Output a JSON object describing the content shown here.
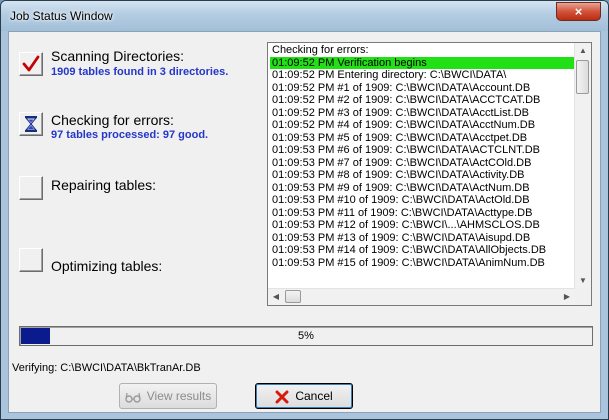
{
  "window": {
    "title": "Job Status Window",
    "close_label": "×"
  },
  "steps": [
    {
      "label": "Scanning Directories:",
      "sub": "1909 tables found in 3 directories.",
      "status_icon": "checkmark-icon"
    },
    {
      "label": "Checking for errors:",
      "sub": "97 tables processed:  97 good.",
      "status_icon": "hourglass-icon"
    },
    {
      "label": "Repairing tables:",
      "sub": "",
      "status_icon": ""
    },
    {
      "label": "Optimizing tables:",
      "sub": "",
      "status_icon": ""
    }
  ],
  "log": [
    "Checking for errors:",
    "01:09:52 PM Verification begins",
    "01:09:52 PM Entering directory: C:\\BWCI\\DATA\\",
    "01:09:52 PM    #1 of 1909: C:\\BWCI\\DATA\\Account.DB",
    "01:09:52 PM    #2 of 1909: C:\\BWCI\\DATA\\ACCTCAT.DB",
    "01:09:52 PM    #3 of 1909: C:\\BWCI\\DATA\\AcctList.DB",
    "01:09:52 PM    #4 of 1909: C:\\BWCI\\DATA\\AcctNum.DB",
    "01:09:53 PM    #5 of 1909: C:\\BWCI\\DATA\\Acctpet.DB",
    "01:09:53 PM    #6 of 1909: C:\\BWCI\\DATA\\ACTCLNT.DB",
    "01:09:53 PM    #7 of 1909: C:\\BWCI\\DATA\\ActCOld.DB",
    "01:09:53 PM    #8 of 1909: C:\\BWCI\\DATA\\Activity.DB",
    "01:09:53 PM    #9 of 1909: C:\\BWCI\\DATA\\ActNum.DB",
    "01:09:53 PM    #10 of 1909: C:\\BWCI\\DATA\\ActOld.DB",
    "01:09:53 PM    #11 of 1909: C:\\BWCI\\DATA\\Acttype.DB",
    "01:09:53 PM    #12 of 1909: C:\\BWCI\\...\\AHMSCLOS.DB",
    "01:09:53 PM    #13 of 1909: C:\\BWCI\\DATA\\Aisupd.DB",
    "01:09:53 PM    #14 of 1909: C:\\BWCI\\DATA\\AllObjects.DB",
    "01:09:53 PM    #15 of 1909: C:\\BWCI\\DATA\\AnimNum.DB"
  ],
  "log_selected_index": 1,
  "log_highlight_color": "#22e016",
  "progress": {
    "value": 0.05,
    "text": "5%"
  },
  "verify": {
    "text": "Verifying:  C:\\BWCI\\DATA\\BkTranAr.DB"
  },
  "buttons": {
    "view_results": "View results",
    "cancel": "Cancel"
  }
}
